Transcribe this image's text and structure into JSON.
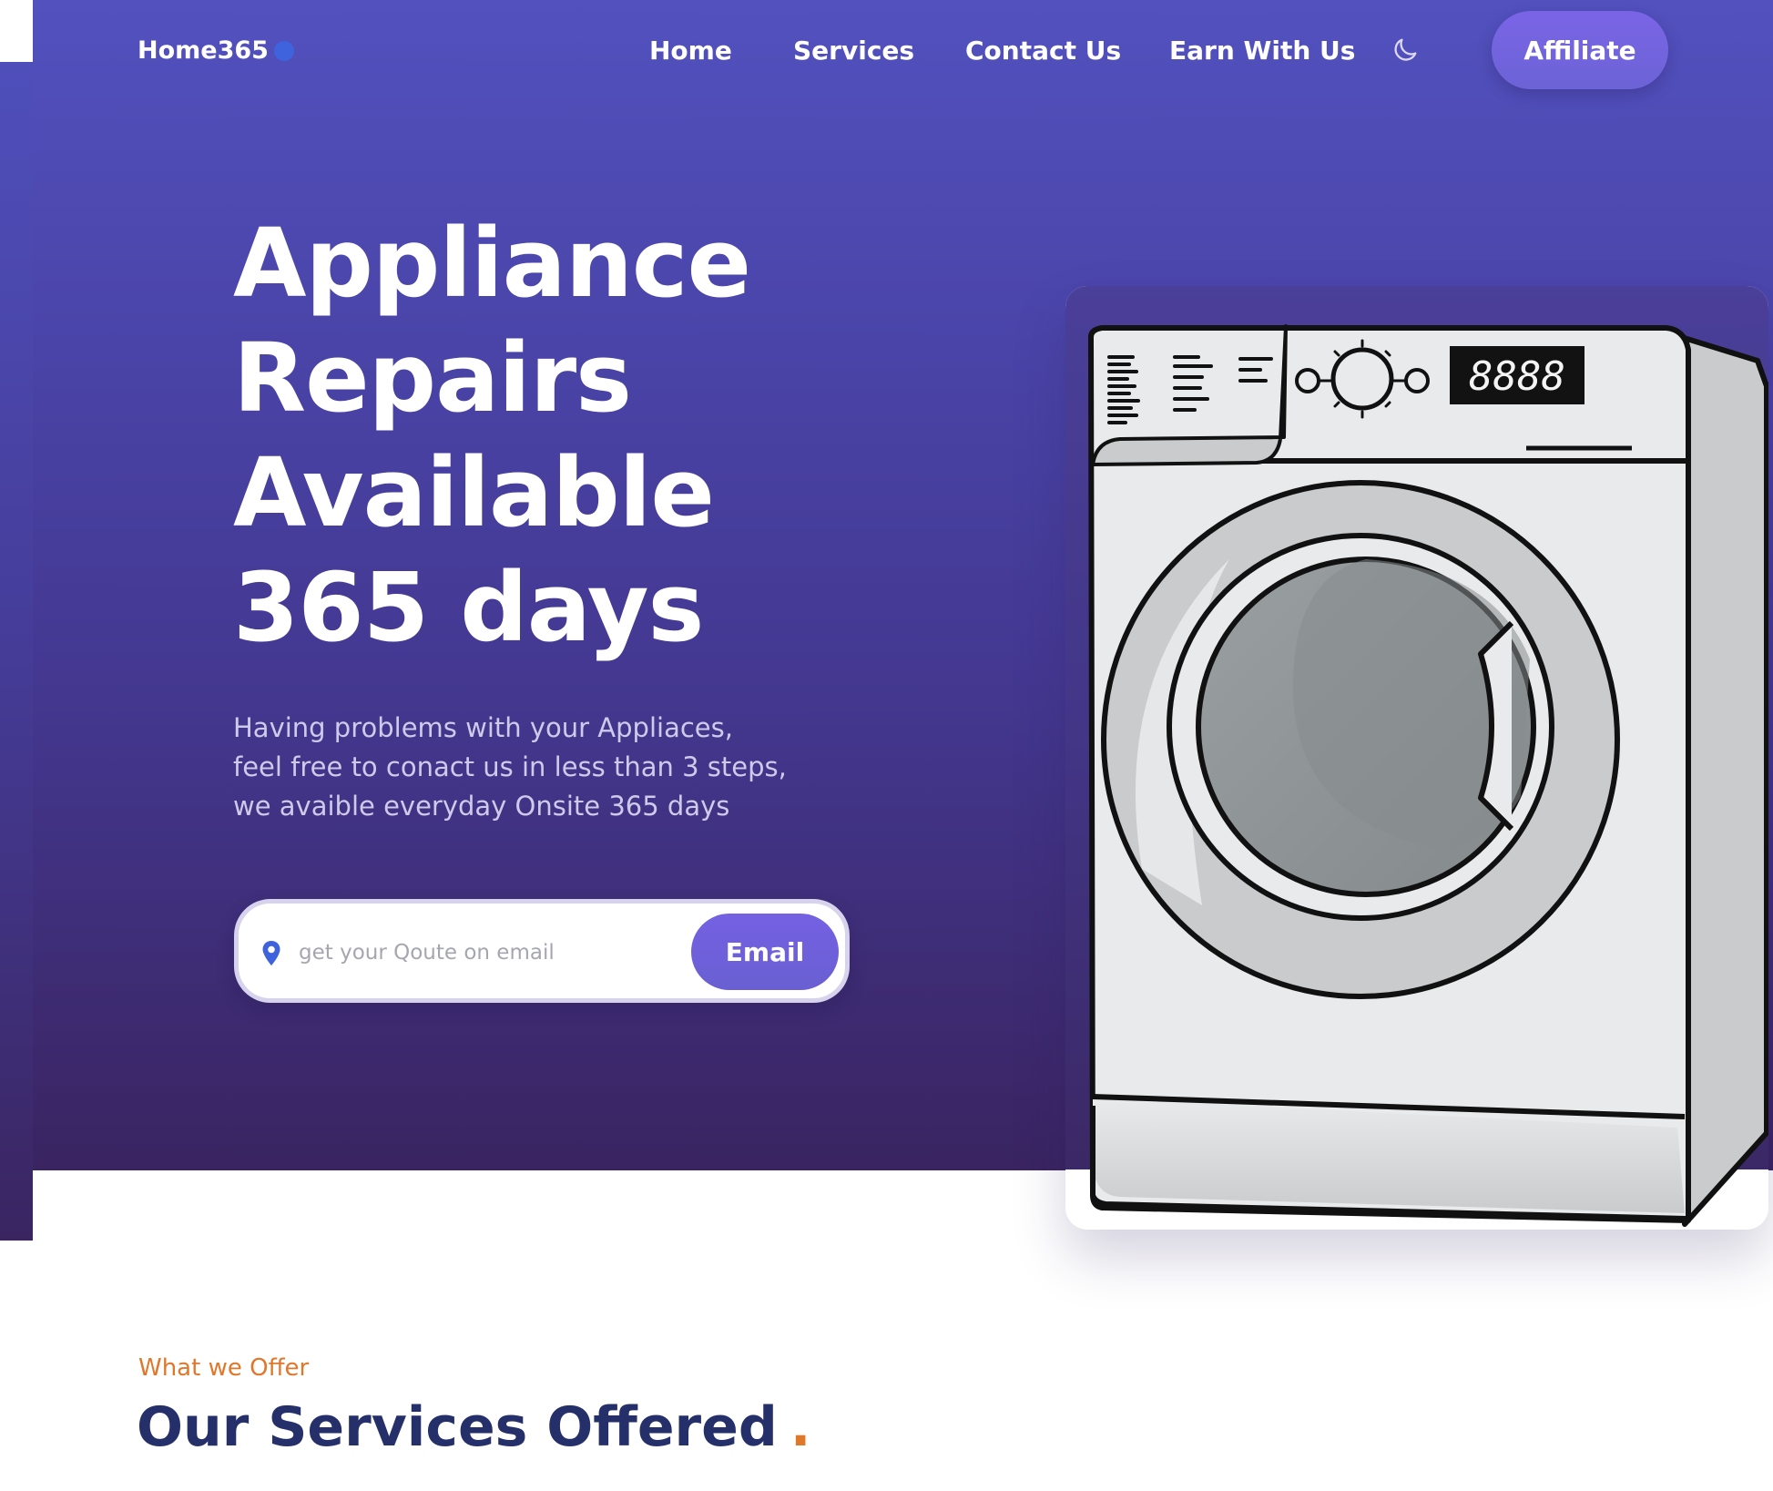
{
  "nav": {
    "brand": "Home365",
    "items": [
      {
        "label": "Home"
      },
      {
        "label": "Services"
      },
      {
        "label": "Contact Us"
      },
      {
        "label": "Earn With Us"
      }
    ],
    "theme_icon": "moon-icon",
    "affiliate_label": "Affiliate"
  },
  "hero": {
    "title_lines": [
      "Appliance",
      "Repairs",
      "Available",
      "365 days"
    ],
    "subtitle_lines": [
      "Having problems with your Appliaces,",
      "feel free to conact us in less than 3 steps,",
      "we avaible everyday Onsite 365 days"
    ],
    "quote_placeholder": "get your Qoute on email",
    "quote_icon": "location-pin-icon",
    "email_button_label": "Email",
    "illustration": {
      "icon": "washing-machine-illustration",
      "display_text": "8888"
    }
  },
  "services": {
    "eyebrow": "What we Offer",
    "title": "Our Services Offered",
    "title_dot": "."
  },
  "colors": {
    "hero_gradient_top": "#5251be",
    "hero_gradient_bottom": "#3a2461",
    "accent_button": "#6c63d6",
    "brand_dot": "#3e63dd",
    "eyebrow_orange": "#e0782c",
    "heading_navy": "#25306a"
  }
}
